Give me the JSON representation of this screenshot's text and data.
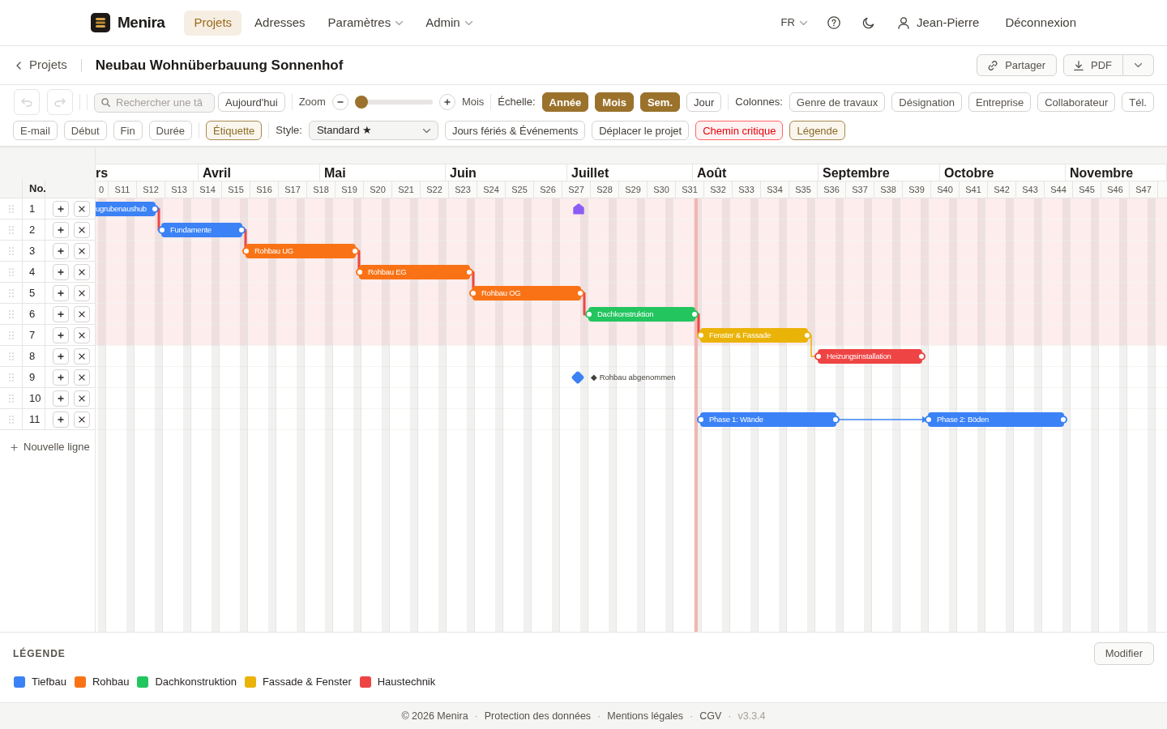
{
  "nav": {
    "brand": "Menira",
    "items": [
      {
        "label": "Projets",
        "selected": true,
        "dropdown": false
      },
      {
        "label": "Adresses",
        "selected": false,
        "dropdown": false
      },
      {
        "label": "Paramètres",
        "selected": false,
        "dropdown": true
      },
      {
        "label": "Admin",
        "selected": false,
        "dropdown": true
      }
    ],
    "language": "FR",
    "user": "Jean-Pierre",
    "logout": "Déconnexion"
  },
  "project": {
    "back": "Projets",
    "title": "Neubau Wohnüberbauung Sonnenhof",
    "share": "Partager",
    "export": "PDF"
  },
  "toolbar": {
    "undo": {
      "disabled": true
    },
    "redo": {
      "disabled": true
    },
    "search": {
      "placeholder": "Rechercher une tâ"
    },
    "today": "Aujourd'hui",
    "zoom": {
      "label": "Zoom",
      "level": 0,
      "unit": "Mois"
    },
    "scale": {
      "label": "Échelle:",
      "options": [
        {
          "label": "Année",
          "selected": true
        },
        {
          "label": "Mois",
          "selected": true
        },
        {
          "label": "Sem.",
          "selected": true
        },
        {
          "label": "Jour",
          "selected": false
        }
      ]
    },
    "columns": {
      "label": "Colonnes:",
      "items": [
        {
          "label": "Genre de travaux",
          "selected": false
        },
        {
          "label": "Désignation",
          "selected": false
        },
        {
          "label": "Entreprise",
          "selected": false
        },
        {
          "label": "Collaborateur",
          "selected": false
        },
        {
          "label": "Tél.",
          "selected": false
        },
        {
          "label": "E-mail",
          "selected": false
        },
        {
          "label": "Début",
          "selected": false
        },
        {
          "label": "Fin",
          "selected": false
        },
        {
          "label": "Durée",
          "selected": false
        }
      ]
    },
    "labels": {
      "label": "Étiquette",
      "selected": true
    },
    "style": {
      "label": "Style:",
      "value": "Standard ★"
    },
    "actions": [
      {
        "label": "Jours fériés & Événements",
        "kind": "toggle",
        "on": false
      },
      {
        "label": "Déplacer le projet",
        "kind": "action",
        "on": false
      },
      {
        "label": "Chemin critique",
        "kind": "critical",
        "on": true
      },
      {
        "label": "Légende",
        "kind": "toggle",
        "on": true
      }
    ]
  },
  "gantt": {
    "number_header": "No.",
    "months": [
      "rs",
      "Avril",
      "Mai",
      "Juin",
      "Juillet",
      "Août",
      "Septembre",
      "Octobre",
      "Novembre"
    ],
    "weeks": [
      "0",
      "S11",
      "S12",
      "S13",
      "S14",
      "S15",
      "S16",
      "S17",
      "S18",
      "S19",
      "S20",
      "S21",
      "S22",
      "S23",
      "S24",
      "S25",
      "S26",
      "S27",
      "S28",
      "S29",
      "S30",
      "S31",
      "S32",
      "S33",
      "S34",
      "S35",
      "S36",
      "S37",
      "S38",
      "S39",
      "S40",
      "S41",
      "S42",
      "S43",
      "S44",
      "S45",
      "S46",
      "S47"
    ],
    "rows": [
      {
        "no": "1",
        "critical": true,
        "items": [
          {
            "kind": "bar",
            "label": "ugrubenaushub",
            "color": "#3b82f6",
            "linked": true
          },
          {
            "kind": "event",
            "color": "#8b5cf6"
          }
        ]
      },
      {
        "no": "2",
        "critical": true,
        "items": [
          {
            "kind": "bar",
            "label": "Fundamente",
            "color": "#3b82f6",
            "linked": true
          }
        ]
      },
      {
        "no": "3",
        "critical": true,
        "items": [
          {
            "kind": "bar",
            "label": "Rohbau UG",
            "color": "#f97316",
            "linked": true
          }
        ]
      },
      {
        "no": "4",
        "critical": true,
        "items": [
          {
            "kind": "bar",
            "label": "Rohbau EG",
            "color": "#f97316",
            "linked": true
          }
        ]
      },
      {
        "no": "5",
        "critical": true,
        "items": [
          {
            "kind": "bar",
            "label": "Rohbau OG",
            "color": "#f97316",
            "linked": true
          }
        ]
      },
      {
        "no": "6",
        "critical": true,
        "items": [
          {
            "kind": "bar",
            "label": "Dachkonstruktion",
            "color": "#22c55e",
            "linked": true
          }
        ]
      },
      {
        "no": "7",
        "critical": true,
        "items": [
          {
            "kind": "bar",
            "label": "Fenster & Fassade",
            "color": "#eab308",
            "linked": true
          }
        ]
      },
      {
        "no": "8",
        "critical": false,
        "items": [
          {
            "kind": "bar",
            "label": "Heizungsinstallation",
            "color": "#ef4444",
            "linked": false
          }
        ]
      },
      {
        "no": "9",
        "critical": false,
        "items": [
          {
            "kind": "milestone",
            "label": "◆ Rohbau abgenommen",
            "color": "#3b82f6"
          }
        ]
      },
      {
        "no": "10",
        "critical": false,
        "items": []
      },
      {
        "no": "11",
        "critical": false,
        "items": [
          {
            "kind": "bar",
            "label": "Phase 1: Wände",
            "color": "#3b82f6",
            "linked": true
          },
          {
            "kind": "bar",
            "label": "Phase 2: Böden",
            "color": "#3b82f6",
            "linked": false
          }
        ]
      }
    ],
    "new_row": "Nouvelle ligne"
  },
  "legend": {
    "title": "LÉGENDE",
    "edit": "Modifier",
    "items": [
      {
        "label": "Tiefbau",
        "color": "#3b82f6"
      },
      {
        "label": "Rohbau",
        "color": "#f97316"
      },
      {
        "label": "Dachkonstruktion",
        "color": "#22c55e"
      },
      {
        "label": "Fassade & Fenster",
        "color": "#eab308"
      },
      {
        "label": "Haustechnik",
        "color": "#ef4444"
      }
    ]
  },
  "footer": [
    {
      "kind": "text",
      "text": "© 2026 Menira"
    },
    {
      "kind": "separator",
      "text": "·"
    },
    {
      "kind": "link",
      "text": "Protection des données"
    },
    {
      "kind": "separator",
      "text": "·"
    },
    {
      "kind": "link",
      "text": "Mentions légales"
    },
    {
      "kind": "separator",
      "text": "·"
    },
    {
      "kind": "link",
      "text": "CGV"
    },
    {
      "kind": "separator",
      "text": "·"
    },
    {
      "kind": "version",
      "text": "v3.3.4"
    }
  ]
}
